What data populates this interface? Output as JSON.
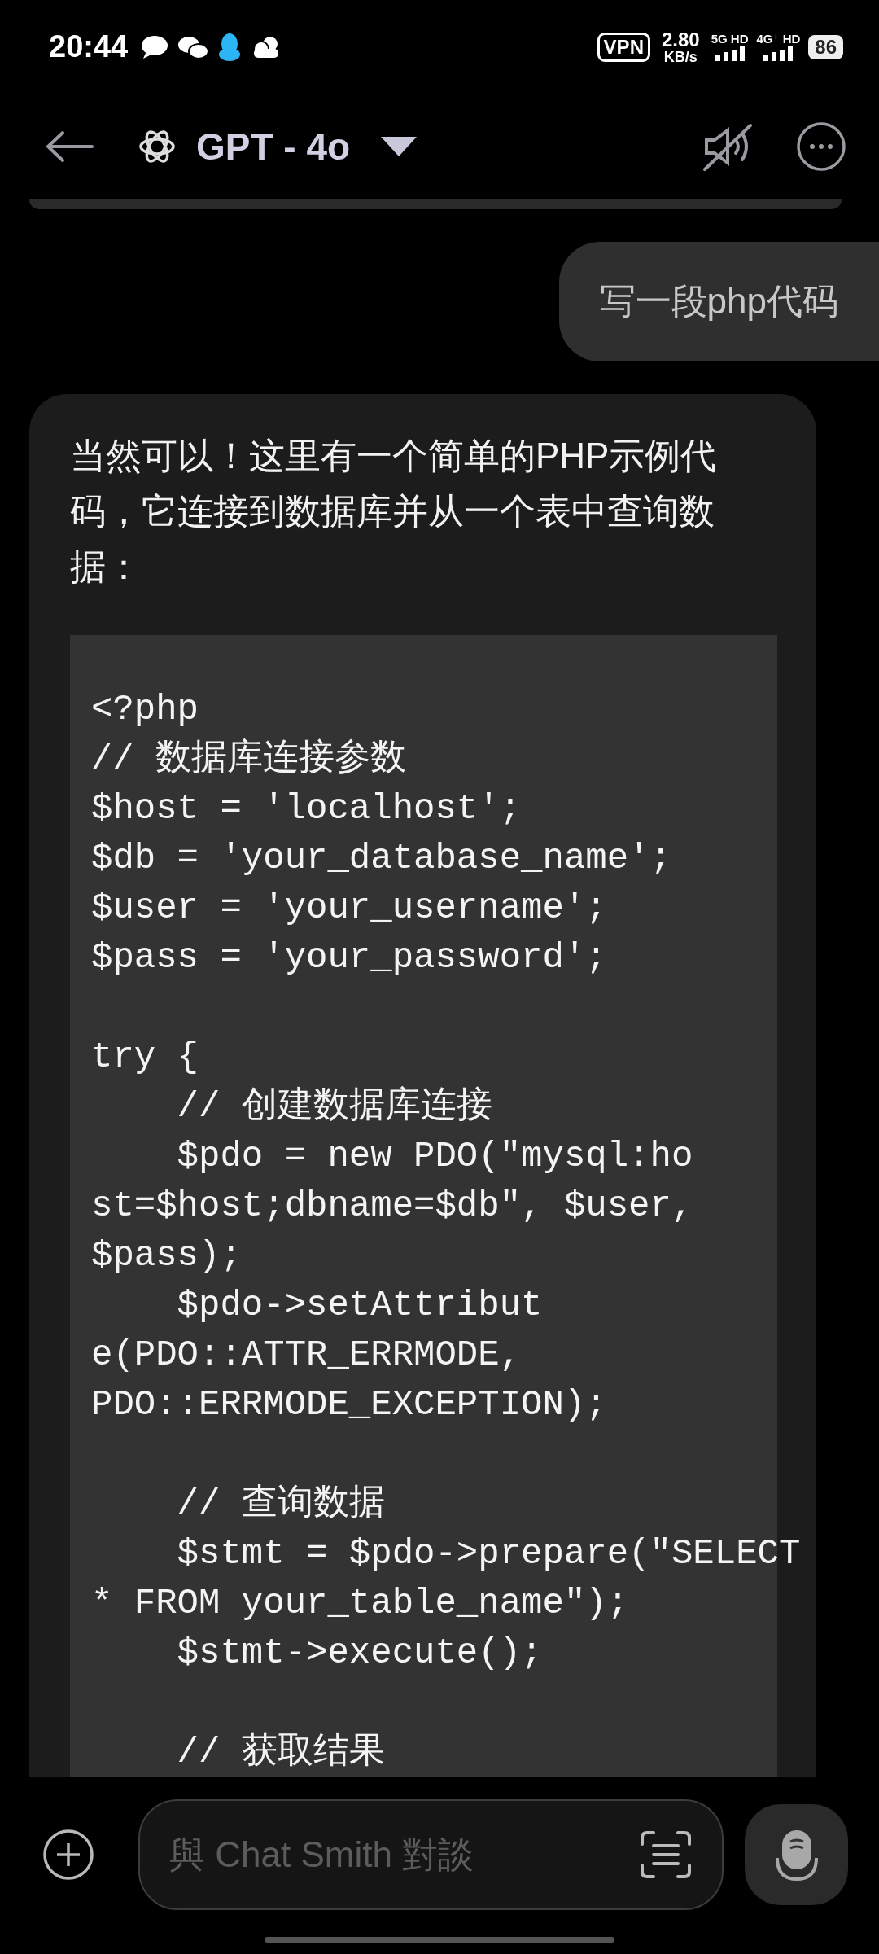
{
  "status_bar": {
    "time": "20:44",
    "vpn": "VPN",
    "speed": "2.80",
    "speed_unit": "KB/s",
    "sim1": "5G HD",
    "sim2": "4G⁺ HD",
    "battery": "86"
  },
  "header": {
    "title": "GPT - 4o"
  },
  "messages": [
    {
      "kind": "user",
      "text": "写一段php代码"
    },
    {
      "kind": "assistant",
      "text": "当然可以！这里有一个简单的PHP示例代码，它连接到数据库并从一个表中查询数据：",
      "code_paragraphs": [
        [
          "<?php",
          "// 数据库连接参数",
          "$host = 'localhost';",
          "$db = 'your_database_name';",
          "$user = 'your_username';",
          "$pass = 'your_password';"
        ],
        [
          "try {",
          "    // 创建数据库连接",
          "    $pdo = new PDO(\"mysql:ho",
          "st=$host;dbname=$db\", $user,",
          "$pass);",
          "    $pdo->setAttribut",
          "e(PDO::ATTR_ERRMODE,",
          "PDO::ERRMODE_EXCEPTION);"
        ],
        [
          "    // 查询数据",
          "    $stmt = $pdo->prepare(\"SELECT",
          "* FROM your_table_name\");",
          "    $stmt->execute();"
        ],
        [
          "    // 获取结果"
        ]
      ]
    }
  ],
  "composer": {
    "placeholder": "與 Chat Smith 對談"
  }
}
